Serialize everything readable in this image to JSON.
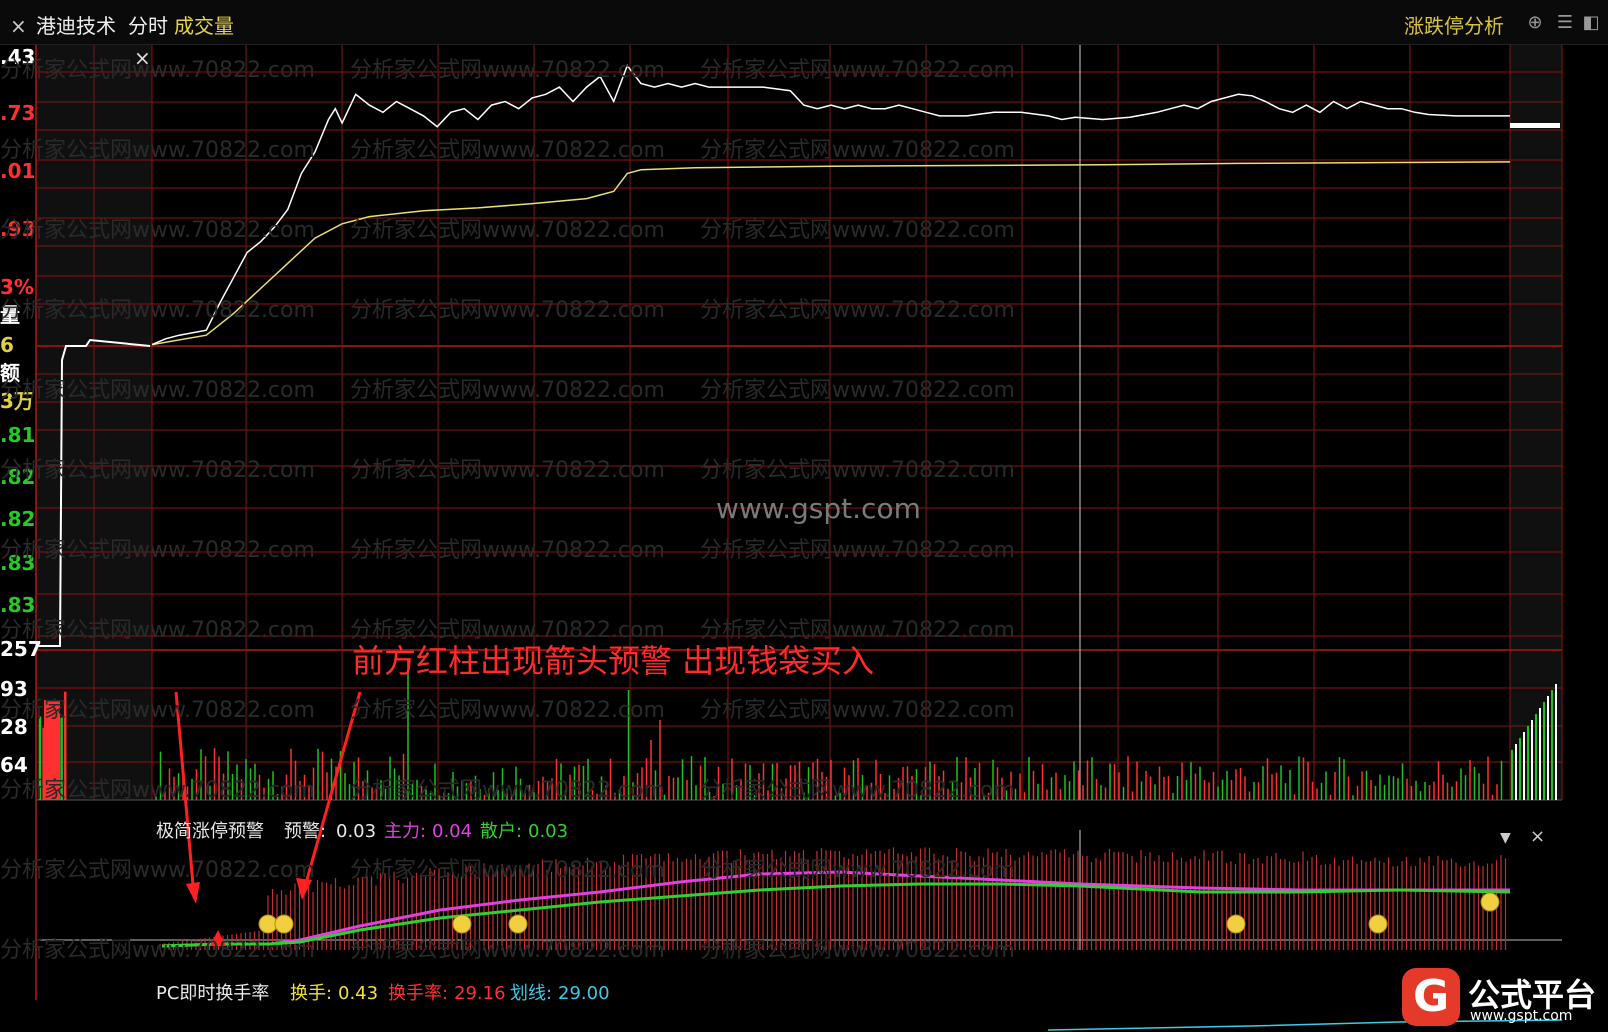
{
  "toolbar": {
    "close_glyph": "×",
    "stock_name": "港迪技术",
    "view_time": "分时",
    "view_volume": "成交量",
    "analysis_link": "涨跌停分析",
    "icon_upload": "upload-icon",
    "icon_menu": "menu-icon",
    "icon_panel": "panel-toggle-icon"
  },
  "left_axis": {
    "labels": [
      {
        "text": ".43",
        "color": "white"
      },
      {
        "text": ".73",
        "color": "red"
      },
      {
        "text": ".01",
        "color": "red"
      },
      {
        "text": ".93",
        "color": "red"
      },
      {
        "text": "3%",
        "color": "red"
      },
      {
        "text": "量",
        "color": "white"
      },
      {
        "text": "6",
        "color": "yellow"
      },
      {
        "text": "额",
        "color": "white"
      },
      {
        "text": "3万",
        "color": "yellow"
      },
      {
        "text": ".81",
        "color": "green"
      },
      {
        "text": ".82",
        "color": "green"
      },
      {
        "text": ".82",
        "color": "green"
      },
      {
        "text": ".83",
        "color": "green"
      },
      {
        "text": ".83",
        "color": "green"
      },
      {
        "text": "257",
        "color": "white"
      },
      {
        "text": "93",
        "color": "white"
      },
      {
        "text": "28",
        "color": "white"
      },
      {
        "text": "64",
        "color": "white"
      }
    ]
  },
  "watermark": {
    "text": "分析家公式网www.70822.com"
  },
  "center_watermark": "www.gspt.com",
  "annotation": "前方红柱出现箭头预警 出现钱袋买入",
  "indicator1": {
    "name": "极简涨停预警",
    "items": [
      {
        "label": "预警:",
        "value": "0.03",
        "color": "#e8e8e8"
      },
      {
        "label": "主力:",
        "value": "0.04",
        "color": "#e040e0"
      },
      {
        "label": "散户:",
        "value": "0.03",
        "color": "#30d030"
      }
    ]
  },
  "indicator2": {
    "name": "PC即时换手率",
    "items": [
      {
        "label": "换手:",
        "value": "0.43",
        "color": "#f0e040"
      },
      {
        "label": "换手率:",
        "value": "29.16",
        "color": "#ff3030"
      },
      {
        "label": "划线:",
        "value": "29.00",
        "color": "#40c8e8"
      }
    ]
  },
  "logo": {
    "glyph": "G",
    "title": "公式平台",
    "url": "www.gspt.com"
  },
  "colors": {
    "grid": "#8b1010",
    "price": "#ffffff",
    "avg": "#e8e070",
    "up": "#ff3030",
    "down": "#20c020",
    "main": "#e040e0",
    "retail": "#30d030"
  },
  "chart_data": {
    "type": "line",
    "price_series": [
      [
        0.0,
        88.2
      ],
      [
        0.01,
        89.0
      ],
      [
        0.02,
        89.5
      ],
      [
        0.04,
        90.2
      ],
      [
        0.05,
        94.0
      ],
      [
        0.06,
        97.5
      ],
      [
        0.07,
        101.0
      ],
      [
        0.08,
        102.5
      ],
      [
        0.09,
        104.5
      ],
      [
        0.1,
        107.0
      ],
      [
        0.11,
        112.0
      ],
      [
        0.12,
        115.0
      ],
      [
        0.13,
        119.5
      ],
      [
        0.135,
        121.0
      ],
      [
        0.14,
        119.0
      ],
      [
        0.15,
        123.0
      ],
      [
        0.16,
        121.5
      ],
      [
        0.17,
        120.5
      ],
      [
        0.18,
        122.0
      ],
      [
        0.19,
        121.0
      ],
      [
        0.2,
        120.0
      ],
      [
        0.21,
        118.5
      ],
      [
        0.22,
        120.5
      ],
      [
        0.23,
        121.0
      ],
      [
        0.24,
        119.5
      ],
      [
        0.25,
        121.5
      ],
      [
        0.26,
        122.0
      ],
      [
        0.27,
        121.0
      ],
      [
        0.28,
        122.5
      ],
      [
        0.29,
        123.0
      ],
      [
        0.3,
        124.0
      ],
      [
        0.31,
        122.0
      ],
      [
        0.32,
        124.0
      ],
      [
        0.33,
        125.5
      ],
      [
        0.34,
        122.0
      ],
      [
        0.35,
        127.0
      ],
      [
        0.36,
        124.5
      ],
      [
        0.37,
        124.0
      ],
      [
        0.38,
        124.5
      ],
      [
        0.39,
        124.0
      ],
      [
        0.4,
        124.5
      ],
      [
        0.41,
        124.0
      ],
      [
        0.42,
        124.0
      ],
      [
        0.45,
        124.0
      ],
      [
        0.47,
        123.5
      ],
      [
        0.48,
        121.5
      ],
      [
        0.49,
        121.0
      ],
      [
        0.5,
        121.5
      ],
      [
        0.51,
        121.0
      ],
      [
        0.52,
        121.5
      ],
      [
        0.53,
        121.0
      ],
      [
        0.54,
        121.0
      ],
      [
        0.55,
        121.5
      ],
      [
        0.56,
        121.0
      ],
      [
        0.57,
        120.5
      ],
      [
        0.58,
        120.0
      ],
      [
        0.6,
        120.0
      ],
      [
        0.62,
        120.5
      ],
      [
        0.64,
        120.5
      ],
      [
        0.66,
        120.0
      ],
      [
        0.67,
        119.5
      ],
      [
        0.68,
        119.8
      ],
      [
        0.7,
        119.5
      ],
      [
        0.72,
        119.8
      ],
      [
        0.74,
        120.5
      ],
      [
        0.75,
        121.0
      ],
      [
        0.76,
        121.5
      ],
      [
        0.77,
        121.0
      ],
      [
        0.78,
        122.0
      ],
      [
        0.79,
        122.5
      ],
      [
        0.8,
        123.0
      ],
      [
        0.81,
        122.8
      ],
      [
        0.82,
        122.0
      ],
      [
        0.83,
        121.0
      ],
      [
        0.84,
        120.5
      ],
      [
        0.85,
        121.5
      ],
      [
        0.86,
        120.5
      ],
      [
        0.87,
        122.0
      ],
      [
        0.88,
        121.0
      ],
      [
        0.89,
        122.0
      ],
      [
        0.9,
        121.5
      ],
      [
        0.91,
        121.0
      ],
      [
        0.92,
        121.0
      ],
      [
        0.93,
        120.5
      ],
      [
        0.94,
        120.2
      ],
      [
        0.96,
        120.0
      ],
      [
        1.0,
        120.0
      ]
    ],
    "avg_series": [
      [
        0.0,
        88.2
      ],
      [
        0.04,
        89.5
      ],
      [
        0.06,
        92.5
      ],
      [
        0.08,
        96.0
      ],
      [
        0.1,
        99.5
      ],
      [
        0.12,
        103.0
      ],
      [
        0.14,
        105.0
      ],
      [
        0.16,
        106.0
      ],
      [
        0.2,
        106.8
      ],
      [
        0.24,
        107.2
      ],
      [
        0.28,
        107.8
      ],
      [
        0.32,
        108.5
      ],
      [
        0.34,
        109.5
      ],
      [
        0.35,
        112.0
      ],
      [
        0.36,
        112.5
      ],
      [
        0.4,
        112.8
      ],
      [
        0.5,
        113.0
      ],
      [
        0.6,
        113.1
      ],
      [
        0.7,
        113.2
      ],
      [
        0.8,
        113.4
      ],
      [
        0.9,
        113.5
      ],
      [
        1.0,
        113.6
      ]
    ]
  }
}
